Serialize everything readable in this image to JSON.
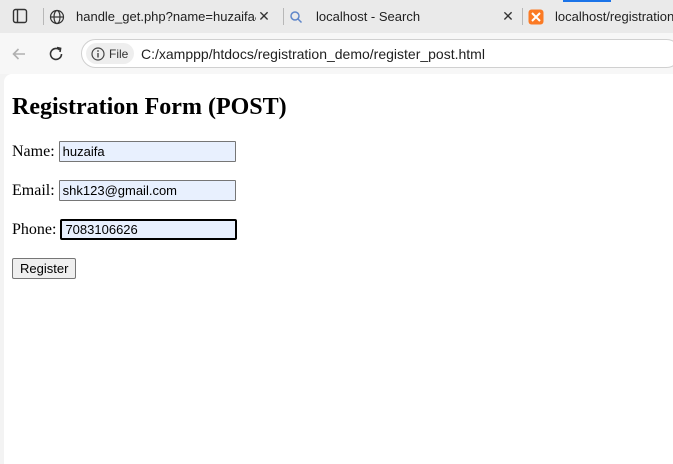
{
  "tabs": [
    {
      "title": "handle_get.php?name=huzaifa&e",
      "icon": "globe-icon"
    },
    {
      "title": "localhost - Search",
      "icon": "search-icon"
    },
    {
      "title": "localhost/registration_",
      "icon": "xampp-icon"
    }
  ],
  "toolbar": {
    "site_info_label": "File",
    "url": "C:/xamppp/htdocs/registration_demo/register_post.html"
  },
  "page": {
    "title": "Registration Form (POST)",
    "name_label": "Name:",
    "name_value": "huzaifa",
    "email_label": "Email:",
    "email_value": "shk123@gmail.com",
    "phone_label": "Phone:",
    "phone_value": "7083106626",
    "submit_label": "Register"
  }
}
